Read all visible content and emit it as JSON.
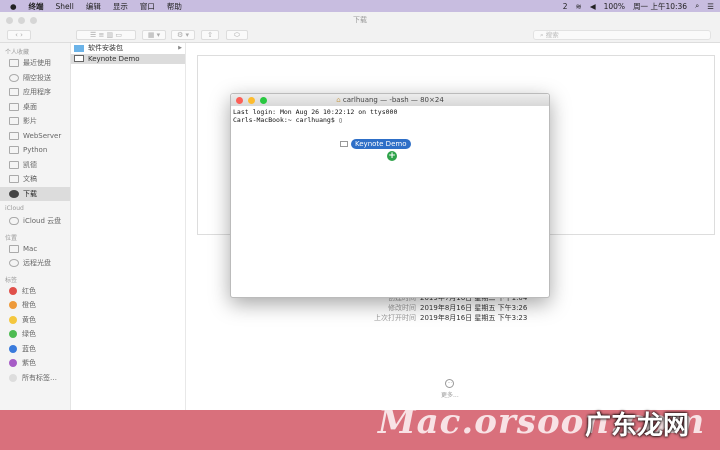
{
  "menubar": {
    "items": [
      "终端",
      "Shell",
      "编辑",
      "显示",
      "窗口",
      "帮助"
    ],
    "qq_count": "2",
    "battery": "100%",
    "clock": "周一 上午10:36"
  },
  "finder": {
    "title": "下载",
    "search_placeholder": "搜索",
    "sidebar": {
      "sections": [
        {
          "header": "个人收藏",
          "items": [
            "最近使用",
            "隔空投送",
            "应用程序",
            "桌面",
            "影片",
            "WebServer",
            "Python",
            "凯德",
            "文稿",
            "下载"
          ]
        },
        {
          "header": "iCloud",
          "items": [
            "iCloud 云盘"
          ]
        },
        {
          "header": "位置",
          "items": [
            "Mac",
            "远程光盘"
          ]
        }
      ],
      "tags_header": "标签",
      "tags": [
        {
          "label": "红色",
          "color": "#e0504a"
        },
        {
          "label": "橙色",
          "color": "#ee9a3a"
        },
        {
          "label": "黄色",
          "color": "#f4c73e"
        },
        {
          "label": "绿色",
          "color": "#4dbb52"
        },
        {
          "label": "蓝色",
          "color": "#3a7bdc"
        },
        {
          "label": "紫色",
          "color": "#a65cc6"
        },
        {
          "label": "所有标签…",
          "color": "#dddddd"
        }
      ]
    },
    "column": [
      {
        "label": "软件安装包"
      },
      {
        "label": "Keynote Demo"
      }
    ],
    "info": [
      {
        "key": "创建时间",
        "value": "2019年7月16日 星期二 下午1:04"
      },
      {
        "key": "修改时间",
        "value": "2019年8月16日 星期五 下午3:26"
      },
      {
        "key": "上次打开时间",
        "value": "2019年8月16日 星期五 下午3:23"
      }
    ],
    "more": "更多..."
  },
  "terminal": {
    "title": "carlhuang — -bash — 80×24",
    "lines": [
      "Last login: Mon Aug 26 10:22:12 on ttys000",
      "Carls-MacBook:~ carlhuang$ ▯"
    ],
    "drag_label": "Keynote Demo"
  },
  "watermark": {
    "text": "Mac.orsoon.com",
    "logo": "广东龙网"
  }
}
